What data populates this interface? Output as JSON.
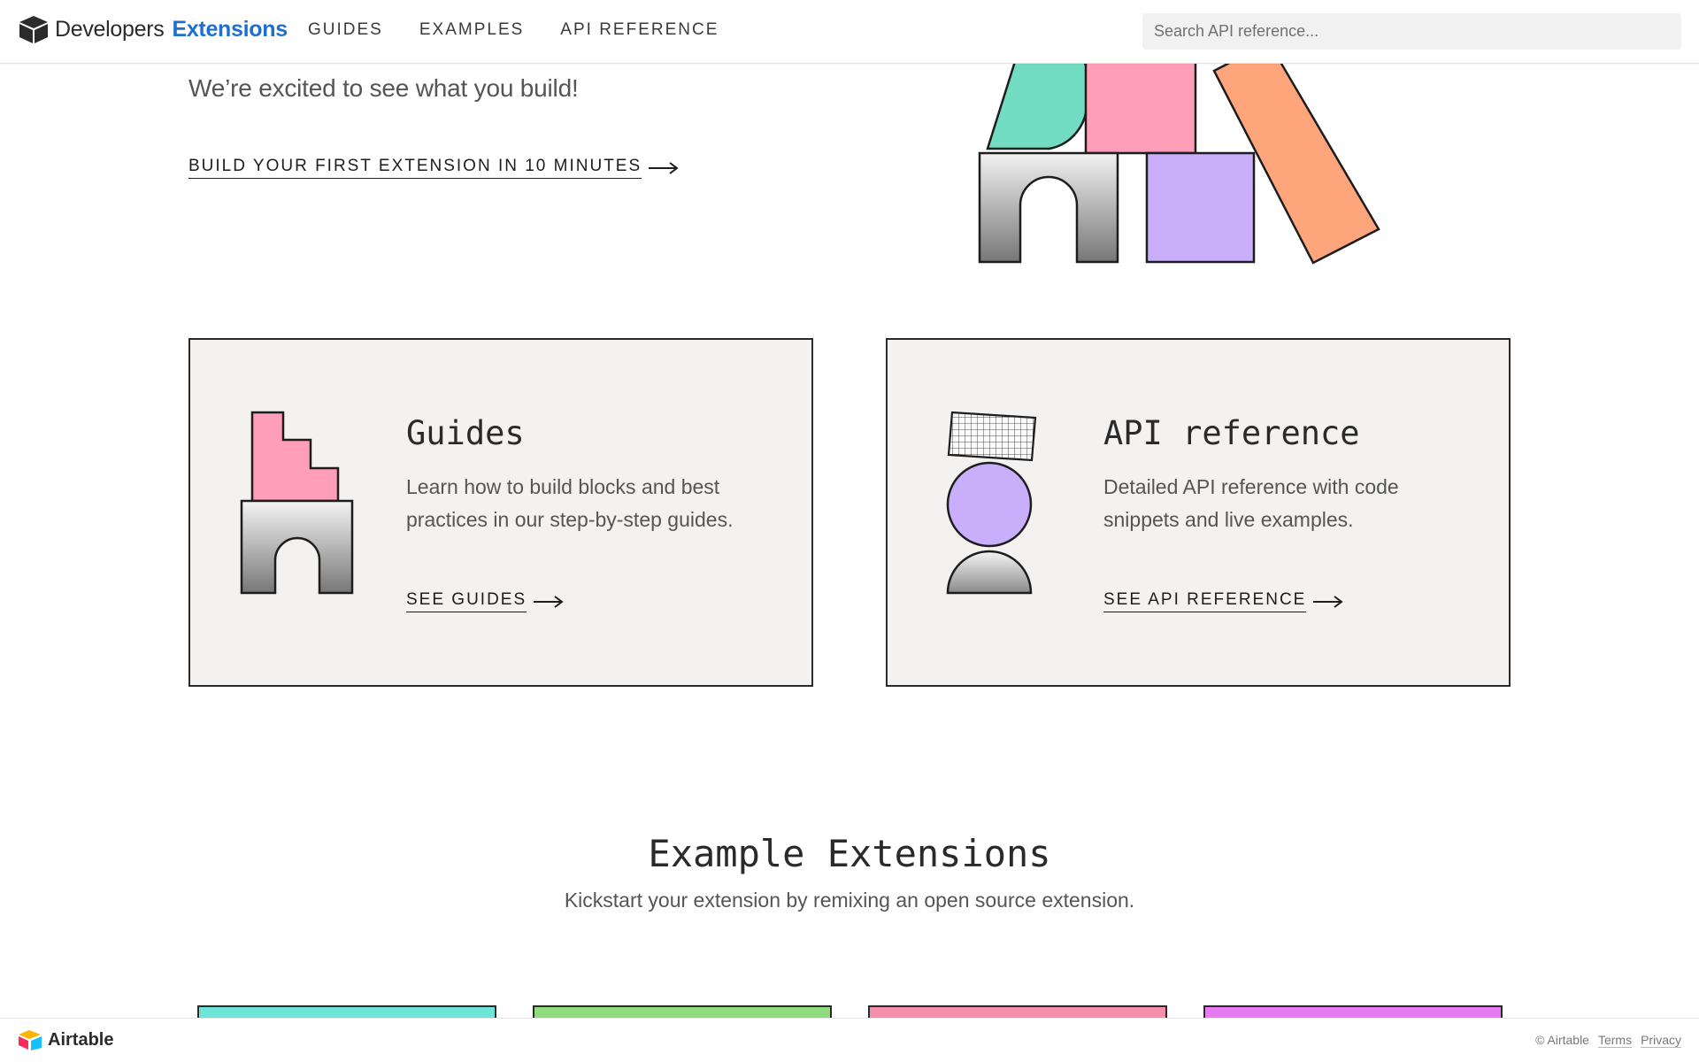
{
  "header": {
    "brand_primary": "Developers",
    "brand_secondary": "Extensions",
    "nav": [
      "GUIDES",
      "EXAMPLES",
      "API REFERENCE"
    ],
    "search_placeholder": "Search API reference..."
  },
  "hero": {
    "subtitle": "We’re excited to see what you build!",
    "cta_label": "BUILD YOUR FIRST EXTENSION IN 10 MINUTES"
  },
  "cards": {
    "guides": {
      "title": "Guides",
      "description": "Learn how to build blocks and best practices in our step-by-step guides.",
      "cta_label": "SEE GUIDES"
    },
    "api": {
      "title": "API reference",
      "description": "Detailed API reference with code snippets and live examples.",
      "cta_label": "SEE API REFERENCE"
    }
  },
  "examples": {
    "title": "Example Extensions",
    "subtitle": "Kickstart your extension by remixing an open source extension.",
    "card_colors": [
      "#6ee3d8",
      "#8fdb7e",
      "#f58fab",
      "#e77bf2"
    ]
  },
  "footer": {
    "brand": "Airtable",
    "copyright": "© Airtable",
    "terms": "Terms",
    "privacy": "Privacy"
  },
  "colors": {
    "accent_blue": "#1f6fd1",
    "pink": "#ff9eb8",
    "purple": "#c9aefc",
    "orange": "#ffa57c",
    "teal": "#72dcc3"
  },
  "icons": [
    "airtable-cube-icon",
    "arrow-right-icon",
    "airtable-logo-icon"
  ]
}
